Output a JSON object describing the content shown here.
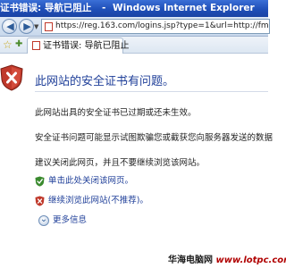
{
  "window": {
    "title_page": "证书错误: 导航已阻止",
    "title_separator": "-",
    "title_app": "Windows Internet Explorer"
  },
  "address_bar": {
    "url": "https://reg.163.com/logins.jsp?type=1&url=http://fm163.163.com/coremail"
  },
  "tab": {
    "label": "证书错误: 导航已阻止"
  },
  "content": {
    "heading": "此网站的安全证书有问题。",
    "paragraphs": [
      "此网站出具的安全证书已过期或还未生效。",
      "安全证书问题可能显示试图欺骗您或截获您向服务器发送的数据",
      "建议关闭此网页，并且不要继续浏览该网站。"
    ],
    "options": [
      {
        "label": "单击此处关闭该网页。",
        "icon": "green-shield-check-icon"
      },
      {
        "label": "继续浏览此网站(不推荐)。",
        "icon": "red-shield-x-icon"
      }
    ],
    "more_info": "更多信息"
  },
  "watermark": {
    "label": "华海电脑网",
    "url": "www.lotpc.com"
  },
  "colors": {
    "title_bar": "#1f4fb8",
    "link_blue": "#1f3f99",
    "error_red": "#c0392b",
    "ok_green": "#3a8a2e"
  }
}
